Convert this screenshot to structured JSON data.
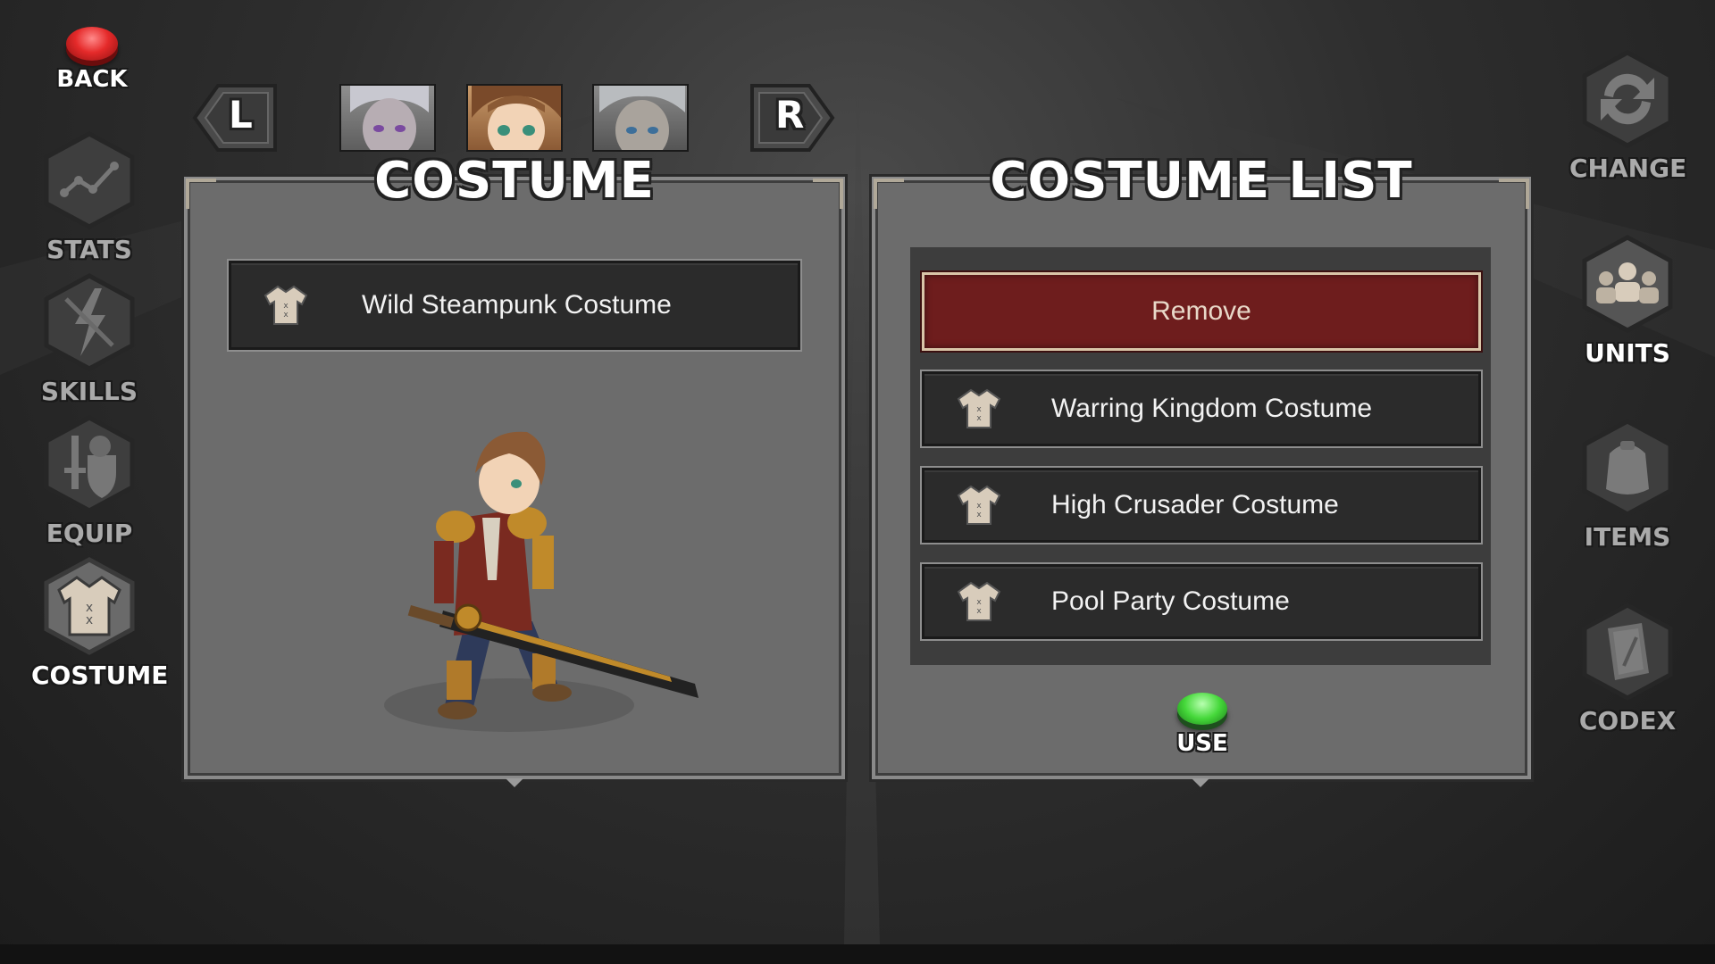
{
  "nav": {
    "back_label": "BACK",
    "left": [
      {
        "label": "STATS",
        "icon": "stats-icon"
      },
      {
        "label": "SKILLS",
        "icon": "skills-icon"
      },
      {
        "label": "EQUIP",
        "icon": "equip-icon"
      },
      {
        "label": "COSTUME",
        "icon": "costume-icon"
      }
    ],
    "right": [
      {
        "label": "CHANGE",
        "icon": "change-icon"
      },
      {
        "label": "UNITS",
        "icon": "units-icon"
      },
      {
        "label": "ITEMS",
        "icon": "items-icon"
      },
      {
        "label": "CODEX",
        "icon": "codex-icon"
      }
    ]
  },
  "character_bar": {
    "prev_label": "L",
    "next_label": "R",
    "portraits": [
      "pale-haired-unit",
      "brown-haired-unit",
      "silver-haired-unit"
    ],
    "selected_index": 1
  },
  "costume_panel": {
    "title": "COSTUME",
    "equipped": "Wild Steampunk Costume"
  },
  "costume_list_panel": {
    "title": "COSTUME LIST",
    "remove_label": "Remove",
    "items": [
      "Warring Kingdom Costume",
      "High Crusader Costume",
      "Pool Party Costume"
    ],
    "use_label": "USE"
  },
  "colors": {
    "remove_bg": "#6e1d1d",
    "panel_bg": "#6c6c6c",
    "row_bg": "#2b2b2b",
    "use_button": "#45d83a",
    "back_button": "#e52a2a"
  }
}
